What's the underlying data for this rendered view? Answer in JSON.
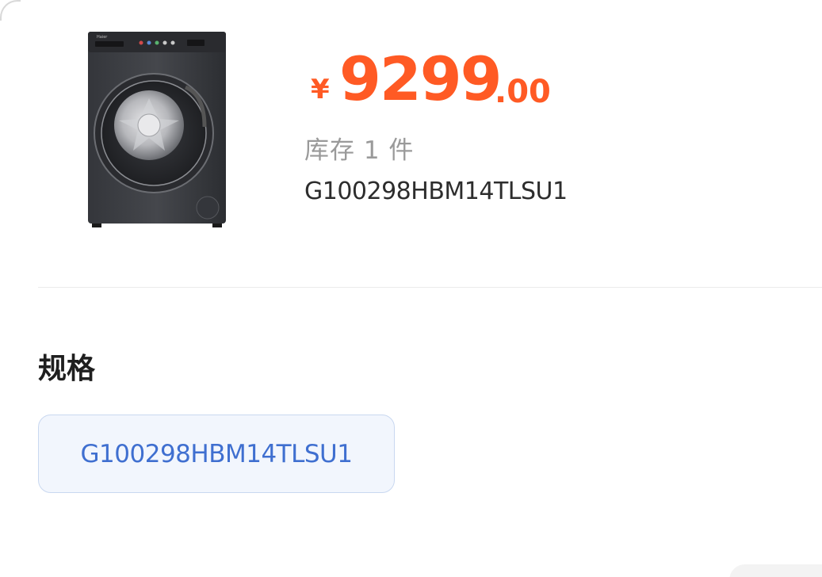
{
  "product": {
    "image_icon": "washing-machine-image",
    "price": {
      "currency": "¥",
      "integer": "9299",
      "decimal": ".00",
      "color": "#ff5a24"
    },
    "stock_text": "库存 1 件",
    "model": "G100298HBM14TLSU1"
  },
  "spec": {
    "title": "规格",
    "options": [
      {
        "label": "G100298HBM14TLSU1",
        "selected": true
      }
    ],
    "selected_color": "#3f6fd0"
  }
}
